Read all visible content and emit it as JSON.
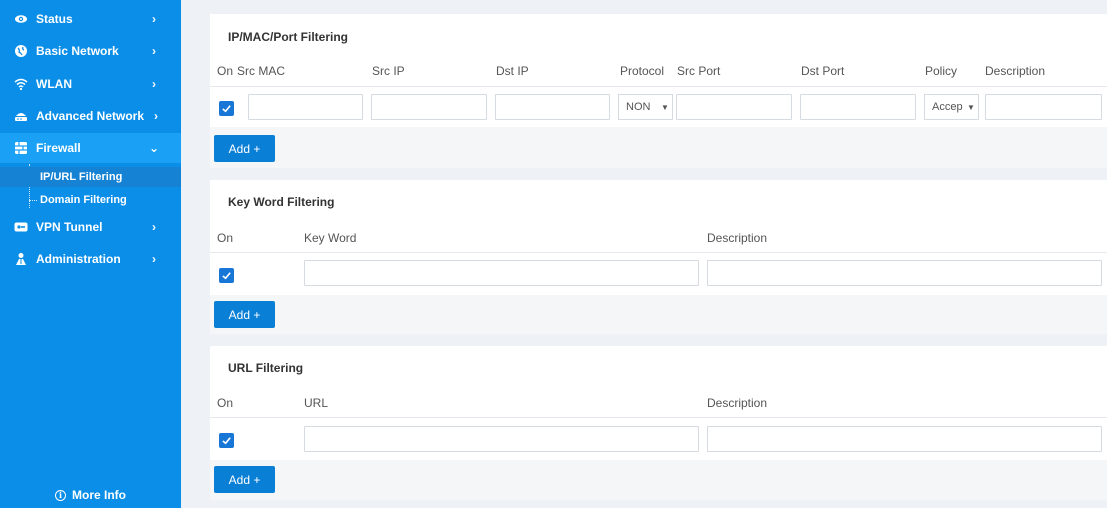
{
  "sidebar": {
    "items": [
      {
        "label": "Status",
        "icon": "eye-icon"
      },
      {
        "label": "Basic Network",
        "icon": "globe-icon"
      },
      {
        "label": "WLAN",
        "icon": "wifi-icon"
      },
      {
        "label": "Advanced Network",
        "icon": "router-icon"
      },
      {
        "label": "Firewall",
        "icon": "firewall-icon"
      },
      {
        "label": "VPN Tunnel",
        "icon": "vpn-icon"
      },
      {
        "label": "Administration",
        "icon": "admin-icon"
      }
    ],
    "subitems": [
      {
        "label": "IP/URL Filtering"
      },
      {
        "label": "Domain Filtering"
      }
    ],
    "more_info": "More Info",
    "colors": {
      "bg": "#0a8ee8",
      "active": "#1aa0f5",
      "sub_active": "#1682d4"
    }
  },
  "ip_mac_port": {
    "title": "IP/MAC/Port Filtering",
    "headers": [
      "On",
      "Src MAC",
      "Src IP",
      "Dst IP",
      "Protocol",
      "Src Port",
      "Dst Port",
      "Policy",
      "Description"
    ],
    "row": {
      "on": true,
      "src_mac": "",
      "src_ip": "",
      "dst_ip": "",
      "protocol": "NON",
      "src_port": "",
      "dst_port": "",
      "policy": "Accep",
      "description": ""
    },
    "add_label": "Add +"
  },
  "keyword": {
    "title": "Key Word Filtering",
    "headers": [
      "On",
      "Key Word",
      "Description"
    ],
    "row": {
      "on": true,
      "keyword": "",
      "description": ""
    },
    "add_label": "Add +"
  },
  "url": {
    "title": "URL Filtering",
    "headers": [
      "On",
      "URL",
      "Description"
    ],
    "row": {
      "on": true,
      "url": "",
      "description": ""
    },
    "add_label": "Add +"
  },
  "colors": {
    "accent": "#0a7fd6",
    "checkbox": "#1877d6"
  }
}
